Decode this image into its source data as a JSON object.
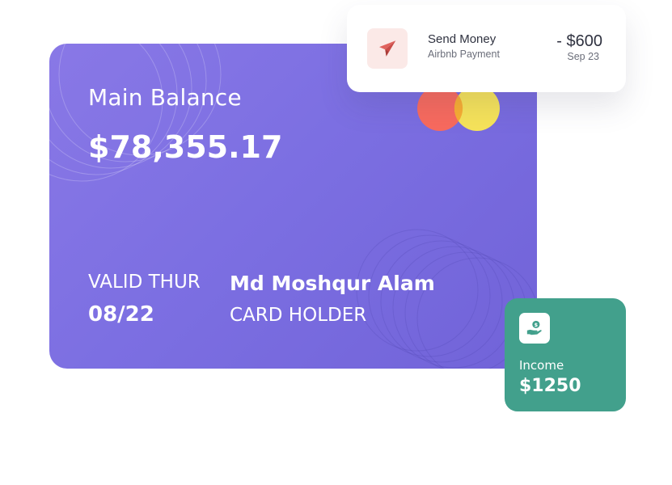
{
  "card": {
    "balance_label": "Main Balance",
    "balance_amount": "$78,355.17",
    "valid_label": "VALID THUR",
    "valid_value": "08/22",
    "holder_name": "Md Moshqur Alam",
    "holder_label": "CARD HOLDER",
    "brand_icon": "mastercard-logo-icon",
    "colors": {
      "gradient_start": "#8978e6",
      "gradient_end": "#7163d8",
      "mc_red": "#f86a5e",
      "mc_yellow": "#f6e35a",
      "mc_overlap": "#f8ad32"
    }
  },
  "transaction": {
    "icon": "paper-plane-icon",
    "title": "Send Money",
    "subtitle": "Airbnb Payment",
    "amount": "- $600",
    "date": "Sep 23",
    "colors": {
      "icon_bg": "#fbe9e7",
      "icon_fg": "#e0625d"
    }
  },
  "income": {
    "icon": "money-hand-icon",
    "label": "Income",
    "value": "$1250",
    "colors": {
      "bg": "#42a08c"
    }
  }
}
